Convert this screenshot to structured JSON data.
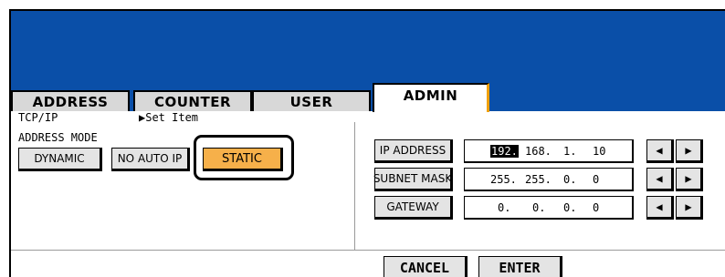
{
  "tabs": [
    {
      "label": "ADDRESS"
    },
    {
      "label": "COUNTER"
    },
    {
      "label": "USER"
    },
    {
      "label": "ADMIN",
      "active": true
    }
  ],
  "breadcrumb": {
    "section": "TCP/IP",
    "arrow": "▶",
    "item": "Set Item"
  },
  "address_mode": {
    "label": "ADDRESS MODE",
    "options": [
      "DYNAMIC",
      "NO AUTO IP",
      "STATIC"
    ],
    "selected": "STATIC"
  },
  "network": {
    "ip_address": {
      "label": "IP ADDRESS",
      "octets": [
        "192.",
        "168.",
        "1.",
        "10"
      ]
    },
    "subnet_mask": {
      "label": "SUBNET MASK",
      "octets": [
        "255.",
        "255.",
        "0.",
        "0"
      ]
    },
    "gateway": {
      "label": "GATEWAY",
      "octets": [
        "0.",
        "0.",
        "0.",
        "0"
      ]
    }
  },
  "icons": {
    "left": "◀",
    "right": "▶"
  },
  "footer": {
    "cancel_label": "CANCEL",
    "enter_label": "ENTER"
  },
  "colors": {
    "banner": "#0a4fa8",
    "selected": "#f6b04a",
    "tab_accent": "#f0a000"
  }
}
